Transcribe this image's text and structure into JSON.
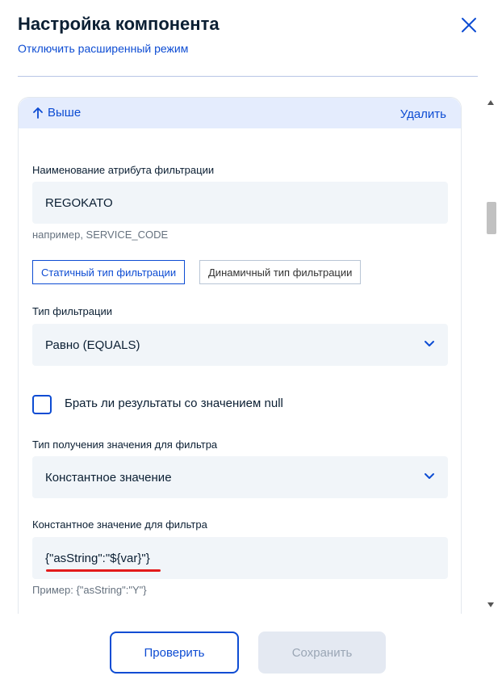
{
  "header": {
    "title": "Настройка компонента",
    "mode_link": "Отключить расширенный режим"
  },
  "card": {
    "up_label": "Выше",
    "delete_label": "Удалить",
    "attr_name_label": "Наименование атрибута фильтрации",
    "attr_name_value": "REGOKATO",
    "attr_name_hint": "например, SERVICE_CODE",
    "filter_mode_static": "Статичный тип фильтрации",
    "filter_mode_dynamic": "Динамичный тип фильтрации",
    "filter_type_label": "Тип фильтрации",
    "filter_type_value": "Равно (EQUALS)",
    "null_checkbox_label": "Брать ли результаты со значением null",
    "value_source_label": "Тип получения значения для фильтра",
    "value_source_value": "Константное значение",
    "const_value_label": "Константное значение для фильтра",
    "const_value_value": "{\"asString\":\"${var}\"}",
    "const_value_hint": "Пример: {\"asString\":\"Y\"}"
  },
  "footer": {
    "check_label": "Проверить",
    "save_label": "Сохранить"
  },
  "colors": {
    "accent": "#0d4cd3",
    "field_bg": "#f1f5f9",
    "card_head_bg": "#e4ecfd",
    "annotation_red": "#e31b1b"
  }
}
